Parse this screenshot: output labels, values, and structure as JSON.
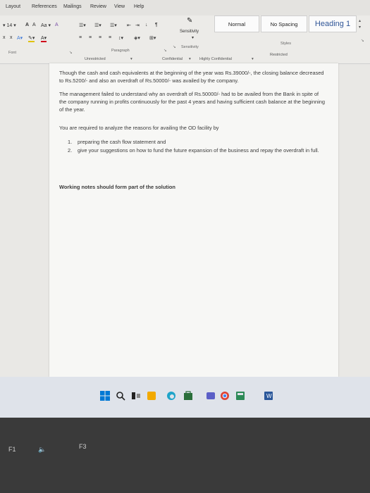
{
  "ribbon": {
    "tabs": [
      "Layout",
      "References",
      "Mailings",
      "Review",
      "View",
      "Help"
    ],
    "font_size": "14",
    "font_group_label": "Font",
    "paragraph_group_label": "Paragraph",
    "sensitivity_button": "Sensitivity",
    "sensitivity_group_label": "Sensitivity",
    "styles": [
      "Normal",
      "No Spacing",
      "Heading 1"
    ],
    "styles_group_label": "Styles",
    "labels": [
      "Unrestricted",
      "Confidential",
      "Highly Confidential",
      "Restricted"
    ]
  },
  "document": {
    "paragraphs": [
      "Though the cash and cash equivalents at the beginning of the year was Rs.39000/-, the closing balance decreased to Rs.5200/- and also an overdraft of Rs.50000/- was availed by the company.",
      "The management failed to understand why an overdraft of Rs.50000/- had to be availed from the Bank in spite of the company running in profits continuously for the past 4 years and having sufficient cash balance at the beginning of the year.",
      "You are required to analyze the reasons for availing the OD facility by"
    ],
    "list": [
      {
        "num": "1.",
        "text": "preparing the cash flow statement and"
      },
      {
        "num": "2.",
        "text": "give your suggestions on how to fund the future expansion of the business and repay the overdraft in full."
      }
    ],
    "note": "Working notes should form part of the solution"
  },
  "keyboard": {
    "keys": [
      "F1",
      "F3"
    ]
  }
}
